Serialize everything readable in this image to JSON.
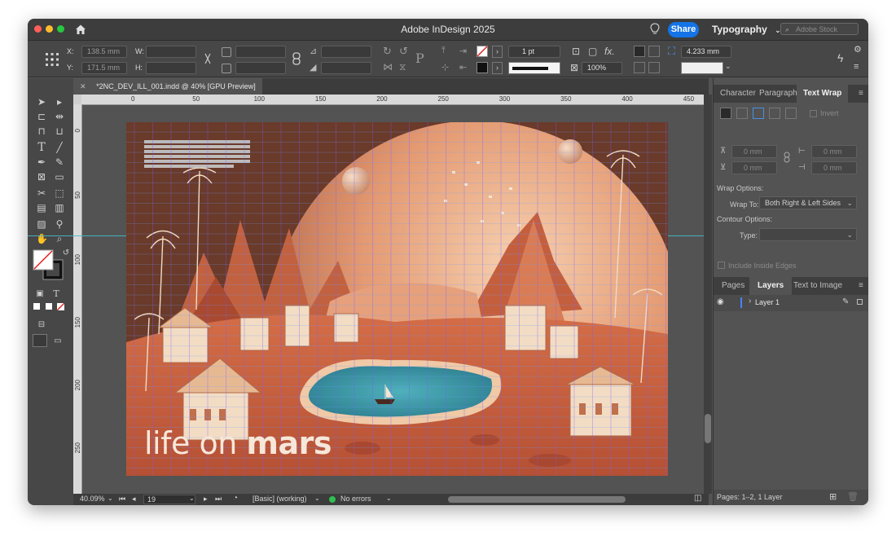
{
  "window": {
    "title": "Adobe InDesign 2025",
    "share_label": "Share",
    "workspace": "Typography",
    "stock_placeholder": "Adobe Stock"
  },
  "controls": {
    "x_label": "X:",
    "x_value": "138.5 mm",
    "y_label": "Y:",
    "y_value": "171.5 mm",
    "w_label": "W:",
    "h_label": "H:",
    "stroke_weight": "1 pt",
    "zoom_percent": "100%",
    "offset_value": "4.233 mm"
  },
  "document": {
    "tab_label": "*2NC_DEV_ILL_001.indd @ 40% [GPU Preview]"
  },
  "ruler": {
    "top_ticks": [
      "0",
      "50",
      "100",
      "150",
      "200",
      "250",
      "300",
      "350",
      "400",
      "450"
    ],
    "left_ticks": [
      "0",
      "50",
      "100",
      "150",
      "200",
      "250"
    ]
  },
  "artwork": {
    "headline_light": "life on ",
    "headline_bold": "mars"
  },
  "status": {
    "zoom": "40.09%",
    "page": "19",
    "profile": "[Basic] (working)",
    "errors": "No errors"
  },
  "text_wrap_panel": {
    "tabs": [
      "Character",
      "Paragraph",
      "Text Wrap"
    ],
    "invert_label": "Invert",
    "top_offset": "0 mm",
    "bottom_offset": "0 mm",
    "left_offset": "0 mm",
    "right_offset": "0 mm",
    "wrap_options_label": "Wrap Options:",
    "wrap_to_label": "Wrap To:",
    "wrap_to_value": "Both Right & Left Sides",
    "contour_options_label": "Contour Options:",
    "type_label": "Type:",
    "include_inside_label": "Include Inside Edges"
  },
  "layers_panel": {
    "tabs": [
      "Pages",
      "Layers",
      "Text to Image"
    ],
    "layer_name": "Layer 1",
    "footer": "Pages: 1–2, 1 Layer"
  },
  "colors": {
    "accent": "#1473e6",
    "mars_orange": "#d9704a",
    "water": "#3e9aa8"
  }
}
